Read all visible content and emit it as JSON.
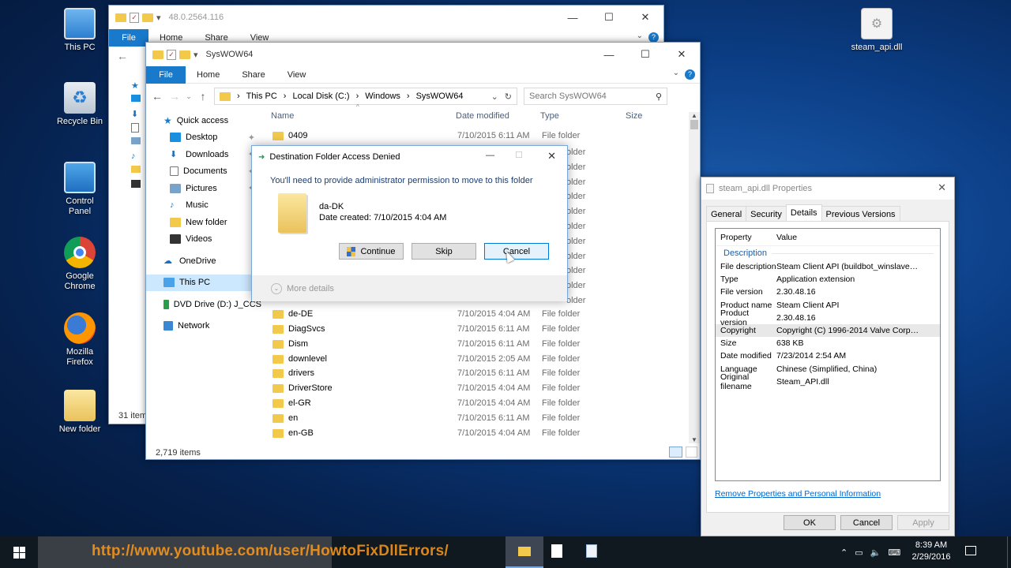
{
  "desktop": {
    "icons": [
      {
        "label": "This PC"
      },
      {
        "label": "Recycle Bin"
      },
      {
        "label": "Control Panel"
      },
      {
        "label": "Google Chrome"
      },
      {
        "label": "Mozilla Firefox"
      },
      {
        "label": "New folder"
      },
      {
        "label": "steam_api.dll"
      }
    ]
  },
  "back_window": {
    "title": "48.0.2564.116",
    "tabs": [
      "File",
      "Home",
      "Share",
      "View"
    ],
    "status": "31 item"
  },
  "explorer": {
    "title": "SysWOW64",
    "tabs": [
      "File",
      "Home",
      "Share",
      "View"
    ],
    "breadcrumb": [
      "This PC",
      "Local Disk (C:)",
      "Windows",
      "SysWOW64"
    ],
    "search_placeholder": "Search SysWOW64",
    "nav": [
      {
        "label": "Quick access"
      },
      {
        "label": "Desktop"
      },
      {
        "label": "Downloads"
      },
      {
        "label": "Documents"
      },
      {
        "label": "Pictures"
      },
      {
        "label": "Music"
      },
      {
        "label": "New folder"
      },
      {
        "label": "Videos"
      },
      {
        "label": "OneDrive"
      },
      {
        "label": "This PC"
      },
      {
        "label": "DVD Drive (D:) J_CCS"
      },
      {
        "label": "Network"
      }
    ],
    "columns": {
      "name": "Name",
      "date": "Date modified",
      "type": "Type",
      "size": "Size"
    },
    "files": [
      {
        "name": "0409",
        "date": "7/10/2015 6:11 AM",
        "type": "File folder"
      },
      {
        "name": "de-DE",
        "date": "7/10/2015 4:04 AM",
        "type": "File folder"
      },
      {
        "name": "DiagSvcs",
        "date": "7/10/2015 6:11 AM",
        "type": "File folder"
      },
      {
        "name": "Dism",
        "date": "7/10/2015 6:11 AM",
        "type": "File folder"
      },
      {
        "name": "downlevel",
        "date": "7/10/2015 2:05 AM",
        "type": "File folder"
      },
      {
        "name": "drivers",
        "date": "7/10/2015 6:11 AM",
        "type": "File folder"
      },
      {
        "name": "DriverStore",
        "date": "7/10/2015 4:04 AM",
        "type": "File folder"
      },
      {
        "name": "el-GR",
        "date": "7/10/2015 4:04 AM",
        "type": "File folder"
      },
      {
        "name": "en",
        "date": "7/10/2015 6:11 AM",
        "type": "File folder"
      },
      {
        "name": "en-GB",
        "date": "7/10/2015 4:04 AM",
        "type": "File folder"
      }
    ],
    "partial_type": "older",
    "status": "2,719 items"
  },
  "dialog": {
    "title": "Destination Folder Access Denied",
    "message": "You'll need to provide administrator permission to move to this folder",
    "folder_name": "da-DK",
    "date_created": "Date created: 7/10/2015 4:04 AM",
    "continue_label": "Continue",
    "skip_label": "Skip",
    "cancel_label": "Cancel",
    "more_details": "More details"
  },
  "properties": {
    "title": "steam_api.dll Properties",
    "tabs": [
      "General",
      "Security",
      "Details",
      "Previous Versions"
    ],
    "header_property": "Property",
    "header_value": "Value",
    "section": "Description",
    "rows": [
      {
        "k": "File description",
        "v": "Steam Client API (buildbot_winslave021..."
      },
      {
        "k": "Type",
        "v": "Application extension"
      },
      {
        "k": "File version",
        "v": "2.30.48.16"
      },
      {
        "k": "Product name",
        "v": "Steam Client API"
      },
      {
        "k": "Product version",
        "v": "2.30.48.16"
      },
      {
        "k": "Copyright",
        "v": "Copyright (C) 1996-2014 Valve Corporati..."
      },
      {
        "k": "Size",
        "v": "638 KB"
      },
      {
        "k": "Date modified",
        "v": "7/23/2014 2:54 AM"
      },
      {
        "k": "Language",
        "v": "Chinese (Simplified, China)"
      },
      {
        "k": "Original filename",
        "v": "Steam_API.dll"
      }
    ],
    "remove_link": "Remove Properties and Personal Information",
    "ok_label": "OK",
    "cancel_label": "Cancel",
    "apply_label": "Apply"
  },
  "taskbar": {
    "watermark": "http://www.youtube.com/user/HowtoFixDllErrors/",
    "time": "8:39 AM",
    "date": "2/29/2016"
  }
}
